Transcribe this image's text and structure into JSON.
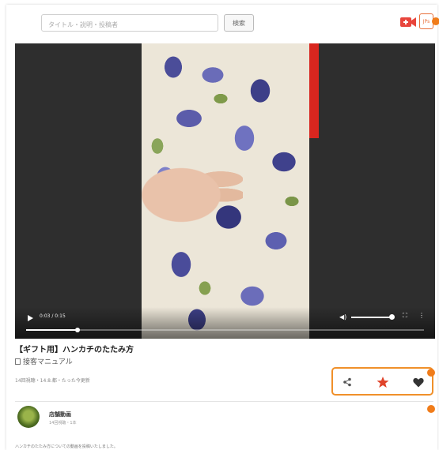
{
  "header": {
    "search_placeholder": "タイトル・説明・投稿者",
    "search_button_label": "検索",
    "user_icon_label": "JPs"
  },
  "player": {
    "time_display": "0:03 / 0:15",
    "progress_fraction": 0.13,
    "volume_fraction": 1.0
  },
  "video": {
    "title": "【ギフト用】ハンカチのたたみ方",
    "category": "接客マニュアル",
    "meta": "14回視聴・14.8.都・たった今更新"
  },
  "actions": {
    "share_icon": "share-icon",
    "favorite_icon": "star-icon",
    "like_icon": "heart-icon"
  },
  "channel": {
    "name": "店舗動画",
    "sub": "14回視聴・1本"
  },
  "description": "ハンカチのたたみ方についての動画を投稿いたしました。",
  "colors": {
    "accent": "#f07c1a",
    "upload_red": "#e8453c",
    "star": "#e0442b"
  }
}
